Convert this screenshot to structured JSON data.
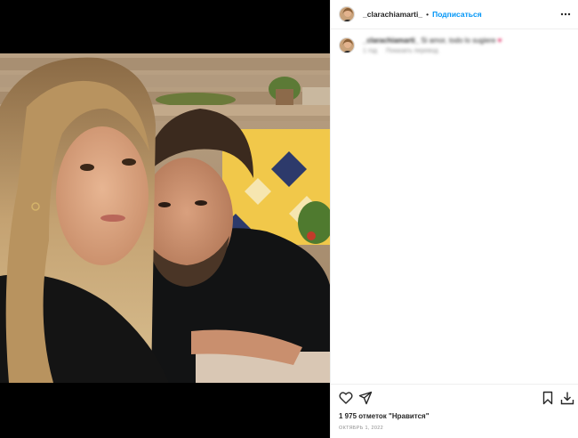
{
  "post": {
    "username": "_clarachiamarti_",
    "separator": "•",
    "follow_label": "Подписаться",
    "more_icon": "more-horizontal-icon"
  },
  "comment": {
    "author": "_clarachiamarti_",
    "text": "Si amor, todo lo sugiere",
    "emoji": "♥",
    "time": "1 год",
    "reply_label": "Показать перевод"
  },
  "actions": {
    "like_icon": "heart-outline-icon",
    "share_icon": "paper-plane-icon",
    "save_icon": "bookmark-icon",
    "download_icon": "download-icon"
  },
  "likes_text": "1 975 отметок \"Нравится\"",
  "date_text": "ОКТЯБРЬ 1, 2022",
  "colors": {
    "follow": "#0095f6",
    "text": "#262626",
    "muted": "#8e8e8e",
    "divider": "#efefef",
    "media_bg": "#000000"
  }
}
